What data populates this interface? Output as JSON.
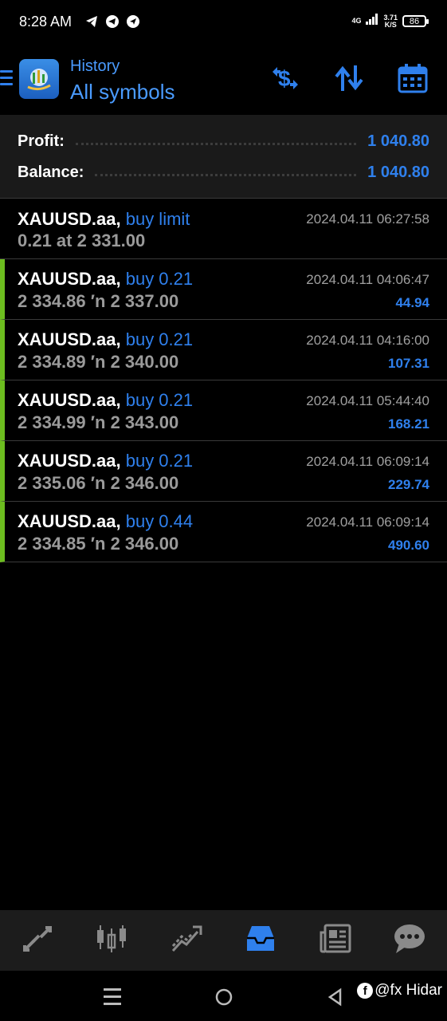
{
  "status_bar": {
    "time": "8:28 AM",
    "network": "4G",
    "speed_value": "3.71",
    "speed_unit": "K/S",
    "battery": "86"
  },
  "header": {
    "subtitle": "History",
    "title": "All symbols",
    "icons": [
      "menu-icon",
      "dollar-swap-icon",
      "sort-arrows-icon",
      "calendar-icon"
    ]
  },
  "summary": {
    "profit_label": "Profit:",
    "profit_value": "1 040.80",
    "balance_label": "Balance:",
    "balance_value": "1 040.80"
  },
  "trades": [
    {
      "symbol": "XAUUSD.aa,",
      "type": "buy limit",
      "details": "0.21 at 2 331.00",
      "time": "2024.04.11 06:27:58",
      "profit": ""
    },
    {
      "symbol": "XAUUSD.aa,",
      "type": "buy 0.21",
      "details": "2 334.86 ′n  2 337.00",
      "time": "2024.04.11 04:06:47",
      "profit": "44.94"
    },
    {
      "symbol": "XAUUSD.aa,",
      "type": "buy 0.21",
      "details": "2 334.89 ′n  2 340.00",
      "time": "2024.04.11 04:16:00",
      "profit": "107.31"
    },
    {
      "symbol": "XAUUSD.aa,",
      "type": "buy 0.21",
      "details": "2 334.99 ′n  2 343.00",
      "time": "2024.04.11 05:44:40",
      "profit": "168.21"
    },
    {
      "symbol": "XAUUSD.aa,",
      "type": "buy 0.21",
      "details": "2 335.06 ′n  2 346.00",
      "time": "2024.04.11 06:09:14",
      "profit": "229.74"
    },
    {
      "symbol": "XAUUSD.aa,",
      "type": "buy 0.44",
      "details": "2 334.85 ′n  2 346.00",
      "time": "2024.04.11 06:09:14",
      "profit": "490.60"
    }
  ],
  "bottom_nav": [
    "quotes-icon",
    "chart-icon",
    "trade-icon",
    "history-icon",
    "news-icon",
    "chat-icon"
  ],
  "watermark": "@fx Hidar",
  "watermark_badge": "f",
  "colors": {
    "accent": "#2f80ed",
    "profit_bar": "#6cbd1f",
    "background": "#000000",
    "summary_bg": "#1a1a1a",
    "nav_bg": "#1c1c1c"
  }
}
